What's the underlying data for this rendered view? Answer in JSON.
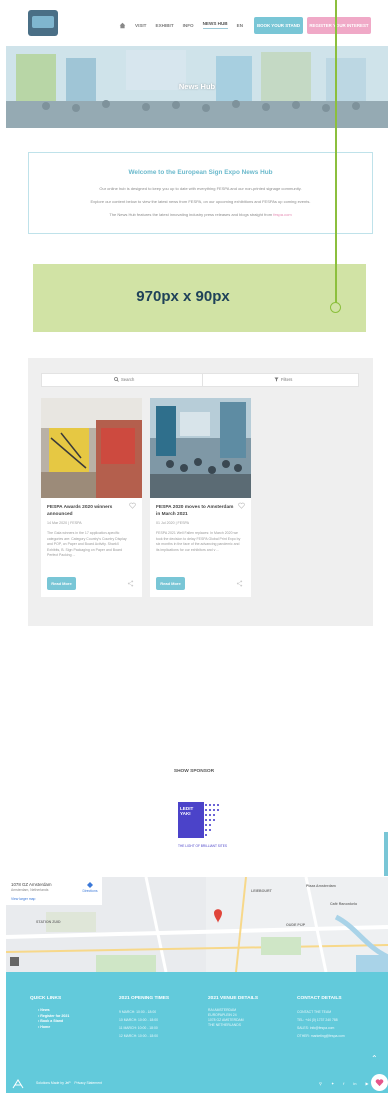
{
  "header": {
    "nav": [
      "VISIT",
      "EXHIBIT",
      "INFO",
      "NEWS HUB",
      "EN"
    ],
    "book_stand": "BOOK YOUR STAND",
    "register": "REGISTER YOUR INTEREST"
  },
  "hero": {
    "title": "News Hub"
  },
  "welcome": {
    "title": "Welcome to the European Sign Expo News Hub",
    "line1": "Our online hub is designed to keep you up to date with everything FESPA and our non-printed signage community.",
    "line2": "Explore our content below to view the latest news from FESPA, on our upcoming exhibitions and FESPAs up coming events.",
    "line3_prefix": "The News Hub features the latest innovating industry press releases and blogs straight from",
    "line3_link": "fespa.com"
  },
  "ad": {
    "text": "970px x 90px"
  },
  "news": {
    "search_label": "Search",
    "filter_label": "Filters",
    "read_more": "Read More",
    "cards": [
      {
        "title": "FESPA Awards 2020 winners announced",
        "date": "14 Mar 2020",
        "author": "FESPA",
        "excerpt": "The Gala winners in the 17 application-specific categories are: Category Country's Country Display and POP, on Paper and Board Activity. SharkX Exhibits, B. Sign Packaging on Paper and Board Perfect Packing ..."
      },
      {
        "title": "FESPA 2020 moves to Amsterdam in March 2021",
        "date": "01 Jul 2020",
        "author": "FESPA",
        "excerpt": "FESPA 2021 Well Fallen replaces: In March 2020 we took the decision to delay FESPA Global Print Expo by six months in the face of the advancing pandemic and its implications for our exhibitors and v ..."
      }
    ]
  },
  "sponsor": {
    "title": "SHOW SPONSOR",
    "brand_line1": "LEDIT",
    "brand_line2": "YAKI",
    "tagline": "THE LIGHT OF BRILLIANT SITES"
  },
  "map": {
    "address_title": "1078 GZ Amsterdam",
    "address_sub": "Amsterdam, Netherlands",
    "directions": "Directions",
    "larger_map": "View larger map",
    "labels": [
      "STATION ZUID",
      "Plaza Amsterdam",
      "LEIEBOURT",
      "Café Ranonkelo",
      "OUDE PIJP"
    ]
  },
  "footer": {
    "quick_links_title": "QUICK LINKS",
    "quick_links": [
      "News",
      "Register for 2021",
      "Book a Stand",
      "Home"
    ],
    "opening_title": "2021 OPENING TIMES",
    "opening": [
      "9 MARCH: 10:00 - 18:00",
      "10 MARCH: 10:00 - 18:00",
      "11 MARCH: 10:00 - 18:00",
      "12 MARCH: 10:00 - 18:00"
    ],
    "venue_title": "2021 VENUE DETAILS",
    "venue": [
      "RAI AMSTERDAM",
      "EUROPAPLEIN 24",
      "1078 GZ AMSTERDAM",
      "THE NETHERLANDS"
    ],
    "contact_title": "CONTACT DETAILS",
    "contact": [
      "CONTACT THE TEAM",
      "TEL: +44 (0) 1737 240 788",
      "SALES: info@fespa.com",
      "OTHER: marketing@fespa.com"
    ],
    "copyright": "Solutions Made by JeP",
    "privacy": "Privacy Statement"
  }
}
